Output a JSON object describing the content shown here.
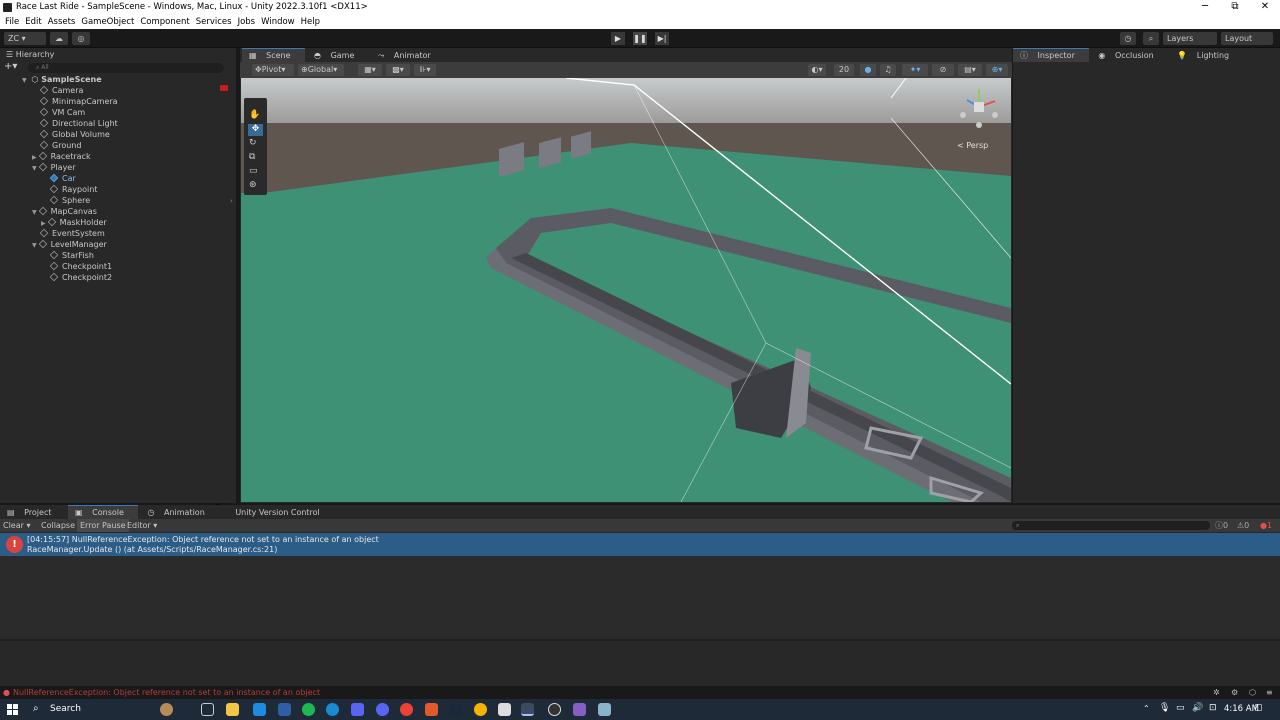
{
  "window": {
    "title": "Race Last Ride - SampleScene - Windows, Mac, Linux - Unity 2022.3.10f1 <DX11>",
    "minimize": "─",
    "maximize": "⧉",
    "close": "✕"
  },
  "menu": [
    "File",
    "Edit",
    "Assets",
    "GameObject",
    "Component",
    "Services",
    "Jobs",
    "Window",
    "Help"
  ],
  "toolbar": {
    "account": "ZC",
    "layers": "Layers",
    "layout": "Layout"
  },
  "hierarchy": {
    "title": "Hierarchy",
    "search_placeholder": "All",
    "scene": "SampleScene",
    "items": [
      {
        "label": "Camera",
        "depth": 1
      },
      {
        "label": "MinimapCamera",
        "depth": 1
      },
      {
        "label": "VM Cam",
        "depth": 1
      },
      {
        "label": "Directional Light",
        "depth": 1
      },
      {
        "label": "Global Volume",
        "depth": 1
      },
      {
        "label": "Ground",
        "depth": 1
      },
      {
        "label": "Racetrack",
        "depth": 1
      },
      {
        "label": "Player",
        "depth": 1
      },
      {
        "label": "Car",
        "depth": 2
      },
      {
        "label": "Raypoint",
        "depth": 2
      },
      {
        "label": "Sphere",
        "depth": 2
      },
      {
        "label": "MapCanvas",
        "depth": 1
      },
      {
        "label": "MaskHolder",
        "depth": 2
      },
      {
        "label": "EventSystem",
        "depth": 1
      },
      {
        "label": "LevelManager",
        "depth": 1
      },
      {
        "label": "StarFish",
        "depth": 2
      },
      {
        "label": "Checkpoint1",
        "depth": 2
      },
      {
        "label": "Checkpoint2",
        "depth": 2
      }
    ]
  },
  "scene_view": {
    "tabs": [
      "Scene",
      "Game",
      "Animator"
    ],
    "pivot": "Pivot",
    "global": "Global",
    "grid_value": "20",
    "persp": "< Persp"
  },
  "inspector": {
    "tabs": [
      "Inspector",
      "Occlusion",
      "Lighting"
    ]
  },
  "console": {
    "tabs": [
      "Project",
      "Console",
      "Animation",
      "Unity Version Control"
    ],
    "buttons": [
      "Clear",
      "Collapse",
      "Error Pause",
      "Editor"
    ],
    "counts": {
      "warnings": "0",
      "info": "0",
      "errors": "1"
    },
    "log": {
      "line1": "[04:15:57] NullReferenceException: Object reference not set to an instance of an object",
      "line2": "RaceManager.Update () (at Assets/Scripts/RaceManager.cs:21)"
    }
  },
  "status": {
    "message": "NullReferenceException: Object reference not set to an instance of an object"
  },
  "taskbar": {
    "search": "Search",
    "time": "4:16 AM"
  },
  "colors": {
    "ground": "#3f9176",
    "sky": "#bfc3c4",
    "selection": "#2c5d87",
    "error": "#c33a3a"
  }
}
